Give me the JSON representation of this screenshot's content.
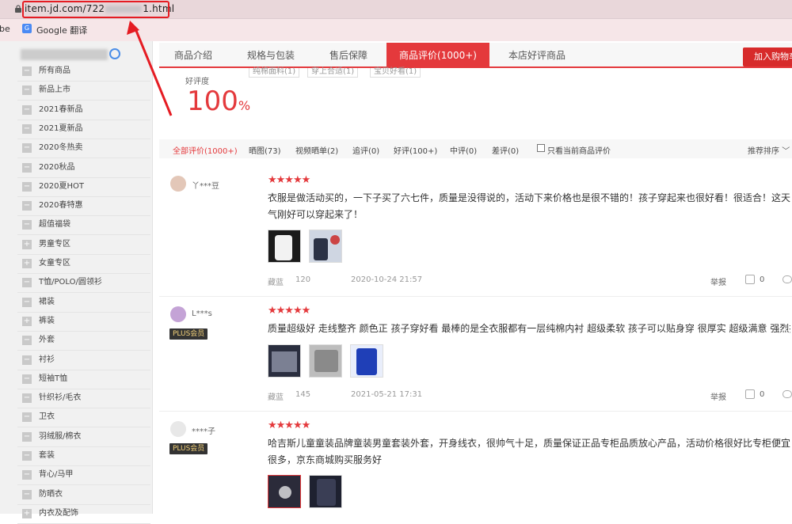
{
  "browser": {
    "url_prefix": "item.jd.com/722",
    "url_suffix": "1.html",
    "bookmarks": [
      {
        "label": "be"
      },
      {
        "label": "Google 翻译"
      }
    ]
  },
  "sidebar": {
    "categories": [
      {
        "label": "所有商品",
        "icon": "minus"
      },
      {
        "label": "新品上市",
        "icon": "minus"
      },
      {
        "label": "2021春新品",
        "icon": "minus"
      },
      {
        "label": "2021夏新品",
        "icon": "minus"
      },
      {
        "label": "2020冬热卖",
        "icon": "minus"
      },
      {
        "label": "2020秋品",
        "icon": "minus"
      },
      {
        "label": "2020夏HOT",
        "icon": "minus"
      },
      {
        "label": "2020春特惠",
        "icon": "minus"
      },
      {
        "label": "超值福袋",
        "icon": "minus"
      },
      {
        "label": "男童专区",
        "icon": "plus"
      },
      {
        "label": "女童专区",
        "icon": "plus"
      },
      {
        "label": "T恤/POLO/圆领衫",
        "icon": "minus"
      },
      {
        "label": "裙装",
        "icon": "minus"
      },
      {
        "label": "裤装",
        "icon": "plus"
      },
      {
        "label": "外套",
        "icon": "minus"
      },
      {
        "label": "衬衫",
        "icon": "minus"
      },
      {
        "label": "短袖T恤",
        "icon": "minus"
      },
      {
        "label": "针织衫/毛衣",
        "icon": "minus"
      },
      {
        "label": "卫衣",
        "icon": "minus"
      },
      {
        "label": "羽绒服/棉衣",
        "icon": "minus"
      },
      {
        "label": "套装",
        "icon": "minus"
      },
      {
        "label": "背心/马甲",
        "icon": "minus"
      },
      {
        "label": "防晒衣",
        "icon": "minus"
      },
      {
        "label": "内衣及配饰",
        "icon": "plus"
      }
    ]
  },
  "tabs": [
    {
      "label": "商品介绍"
    },
    {
      "label": "规格与包装"
    },
    {
      "label": "售后保障"
    },
    {
      "label": "商品评价(1000+)",
      "active": true
    },
    {
      "label": "本店好评商品"
    }
  ],
  "cart_button": "加入购物车",
  "tags": [
    "纯棉面料(1)",
    "穿上合适(1)",
    "宝贝好看(1)"
  ],
  "rating": {
    "label": "好评度",
    "value": "100",
    "unit": "%"
  },
  "filters": [
    {
      "label": "全部评价(1000+)",
      "active": true
    },
    {
      "label": "晒图(73)"
    },
    {
      "label": "视频晒单(2)"
    },
    {
      "label": "追评(0)"
    },
    {
      "label": "好评(100+)"
    },
    {
      "label": "中评(0)"
    },
    {
      "label": "差评(0)"
    }
  ],
  "only_current_label": "只看当前商品评价",
  "sort_label": "推荐排序",
  "report_label": "举报",
  "plus_label": "PLUS会员",
  "reviews": [
    {
      "user": "丫***豆",
      "stars": "★★★★★",
      "text": "衣服是做活动买的，一下子买了六七件，质量是没得说的，活动下来价格也是很不错的！孩子穿起来也很好看！很适合！这天气刚好可以穿起来了！",
      "variant": "藏蓝",
      "size": "120",
      "date": "2020-10-24 21:57",
      "likes": "0",
      "plus": false
    },
    {
      "user": "L***s",
      "stars": "★★★★★",
      "text": "质量超级好 走线整齐 颜色正 孩子穿好看 最棒的是全衣服都有一层纯棉内衬 超级柔软 孩子可以贴身穿 很厚实 超级满意 强烈推荐",
      "variant": "藏蓝",
      "size": "145",
      "date": "2021-05-21 17:31",
      "likes": "0",
      "plus": true
    },
    {
      "user": "****子",
      "stars": "★★★★★",
      "text": "哈吉斯儿童童装品牌童装男童套装外套，开身线衣，很帅气十足，质量保证正品专柜品质放心产品，活动价格很好比专柜便宜很多，京东商城购买服务好",
      "plus": true
    }
  ],
  "colors": {
    "accent": "#e4393c",
    "highlight": "#e51c23"
  }
}
